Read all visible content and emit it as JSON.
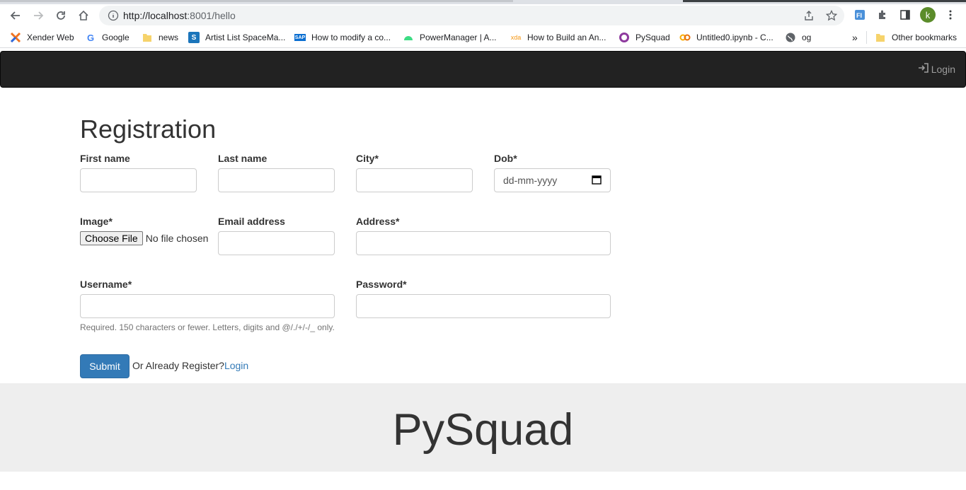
{
  "browser": {
    "url_host": "http://localhost",
    "url_rest": ":8001/hello",
    "avatar_letter": "k",
    "bookmarks": [
      {
        "label": "Xender Web",
        "icon": "xender-icon"
      },
      {
        "label": "Google",
        "icon": "google-icon"
      },
      {
        "label": "news",
        "icon": "folder-icon"
      },
      {
        "label": "Artist List SpaceMa...",
        "icon": "s-icon"
      },
      {
        "label": "How to modify a co...",
        "icon": "sap-icon"
      },
      {
        "label": "PowerManager | A...",
        "icon": "android-icon"
      },
      {
        "label": "How to Build an An...",
        "icon": "xda-icon"
      },
      {
        "label": "PySquad",
        "icon": "ring-icon"
      },
      {
        "label": "Untitled0.ipynb - C...",
        "icon": "colab-icon"
      },
      {
        "label": "og",
        "icon": "globe-icon"
      }
    ],
    "overflow": "»",
    "other_bookmarks": "Other bookmarks"
  },
  "navbar": {
    "login_label": "Login"
  },
  "form": {
    "title": "Registration",
    "first_name_label": "First name",
    "last_name_label": "Last name",
    "city_label": "City*",
    "dob_label": "Dob*",
    "dob_placeholder": "dd-mm-yyyy",
    "image_label": "Image*",
    "choose_file_label": "Choose File",
    "no_file_text": "No file chosen",
    "email_label": "Email address",
    "address_label": "Address*",
    "username_label": "Username*",
    "username_help": "Required. 150 characters or fewer. Letters, digits and @/./+/-/_ only.",
    "password_label": "Password*",
    "submit_label": "Submit",
    "already_text": "Or Already Register?",
    "login_link": "Login"
  },
  "footer": {
    "title": "PySquad"
  },
  "colors": {
    "navbar": "#222222",
    "primary": "#337ab7",
    "footer": "#eeeeee"
  }
}
